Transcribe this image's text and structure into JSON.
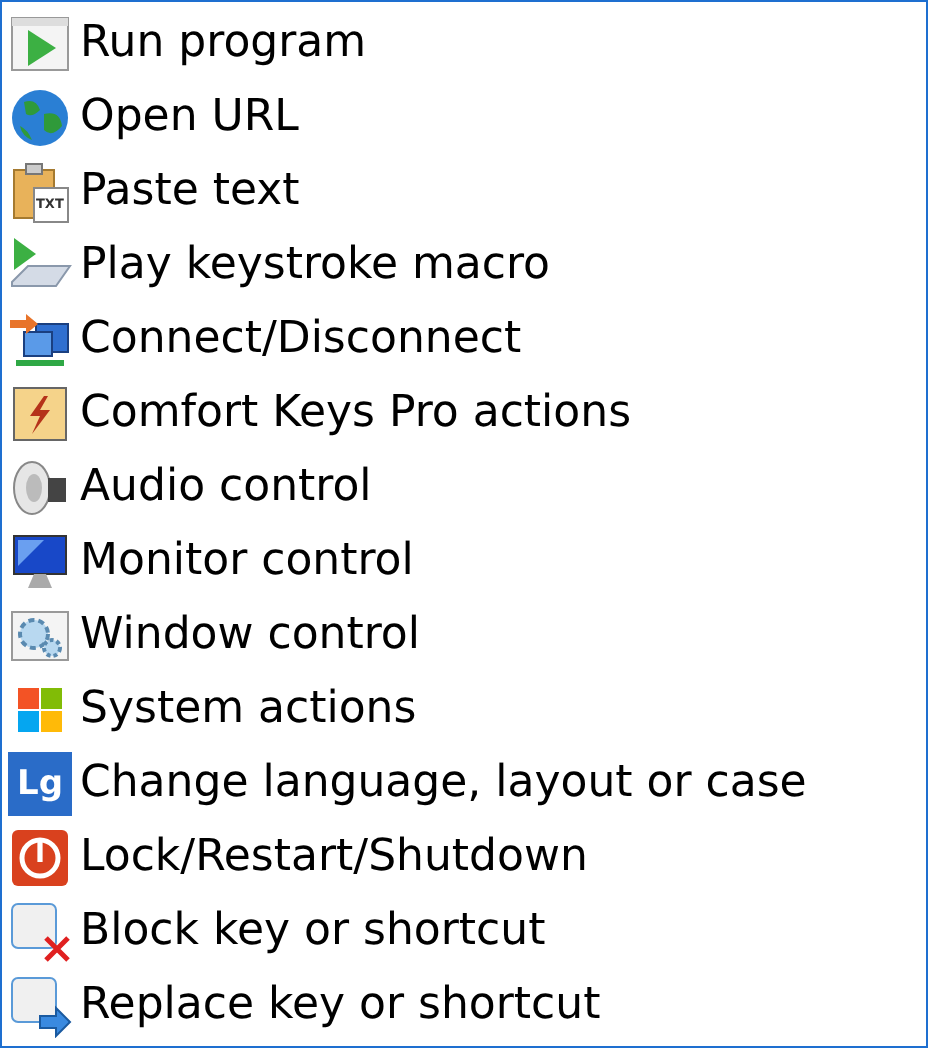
{
  "menu": {
    "items": [
      {
        "kind": "run",
        "label": "Run program"
      },
      {
        "kind": "globe",
        "label": "Open URL"
      },
      {
        "kind": "paste",
        "label": "Paste text",
        "icon_text": "TXT"
      },
      {
        "kind": "macro",
        "label": "Play keystroke macro"
      },
      {
        "kind": "network",
        "label": "Connect/Disconnect"
      },
      {
        "kind": "bolt",
        "label": "Comfort Keys Pro actions"
      },
      {
        "kind": "speaker",
        "label": "Audio control"
      },
      {
        "kind": "monitor",
        "label": "Monitor control"
      },
      {
        "kind": "gears",
        "label": "Window control"
      },
      {
        "kind": "windows",
        "label": "System actions"
      },
      {
        "kind": "language",
        "label": "Change language, layout or case",
        "icon_text": "Lg"
      },
      {
        "kind": "power",
        "label": "Lock/Restart/Shutdown"
      },
      {
        "kind": "block",
        "label": "Block key or shortcut"
      },
      {
        "kind": "replace",
        "label": "Replace key or shortcut"
      }
    ]
  }
}
